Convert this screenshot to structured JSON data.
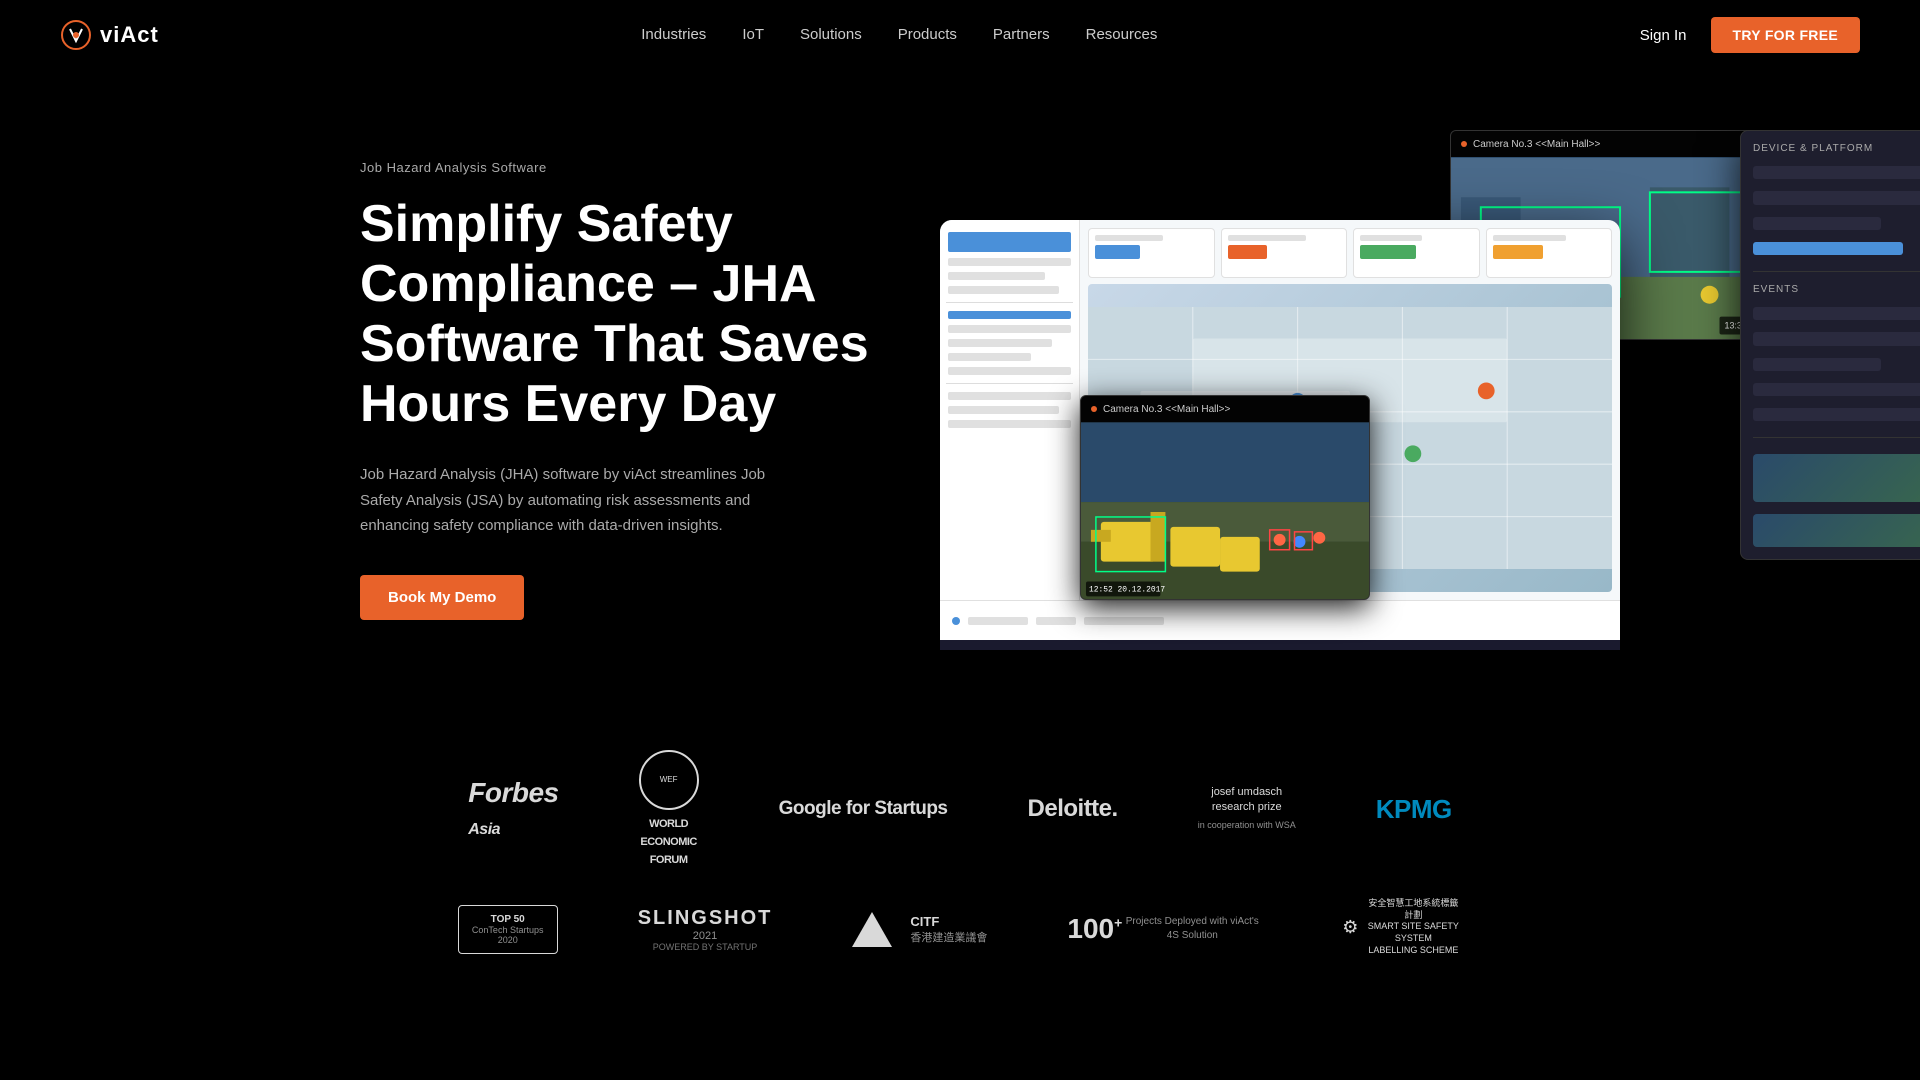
{
  "brand": {
    "name": "viAct",
    "logo_alt": "viAct logo"
  },
  "navbar": {
    "links": [
      {
        "id": "industries",
        "label": "Industries"
      },
      {
        "id": "iot",
        "label": "IoT"
      },
      {
        "id": "solutions",
        "label": "Solutions"
      },
      {
        "id": "products",
        "label": "Products"
      },
      {
        "id": "partners",
        "label": "Partners"
      },
      {
        "id": "resources",
        "label": "Resources"
      }
    ],
    "sign_in": "Sign In",
    "try_free": "TRY FOR FREE"
  },
  "hero": {
    "subtitle": "Job Hazard Analysis Software",
    "title": "Simplify Safety Compliance – JHA Software That Saves Hours Every Day",
    "description": "Job Hazard Analysis (JHA) software by viAct streamlines Job Safety Analysis (JSA) by automating risk assessments and enhancing safety compliance with data-driven insights.",
    "cta": "Book My Demo"
  },
  "camera_top": {
    "label": "Camera No.3 <<Main Hall>>"
  },
  "camera_mid": {
    "label": "Camera No.3 <<Main Hall>>",
    "timestamp": "12:52",
    "date": "20.12.2017"
  },
  "logos_row1": [
    {
      "id": "forbes",
      "text": "Forbes Asia"
    },
    {
      "id": "wef",
      "text": "WORLD ECONOMIC FORUM"
    },
    {
      "id": "google",
      "text": "Google for Startups"
    },
    {
      "id": "deloitte",
      "text": "Deloitte."
    },
    {
      "id": "josef",
      "text": "josef umdasch research prize"
    },
    {
      "id": "kpmg",
      "text": "kpmg"
    }
  ],
  "logos_row2": [
    {
      "id": "top50",
      "text": "TOP 50 ConTech Startups 2020"
    },
    {
      "id": "slingshot",
      "text": "SLINGSHOT 2021 POWERED BY STARTUP"
    },
    {
      "id": "citf",
      "text": "CITF 香港建造業議會"
    },
    {
      "id": "100plus",
      "label": "100+",
      "sub": "Projects Deployed with viAct's 4S Solution"
    },
    {
      "id": "4s",
      "text": "安全智慧工地系統標籤計劃 SMART SITE SAFETY SYSTEM LABELLING SCHEME"
    }
  ]
}
